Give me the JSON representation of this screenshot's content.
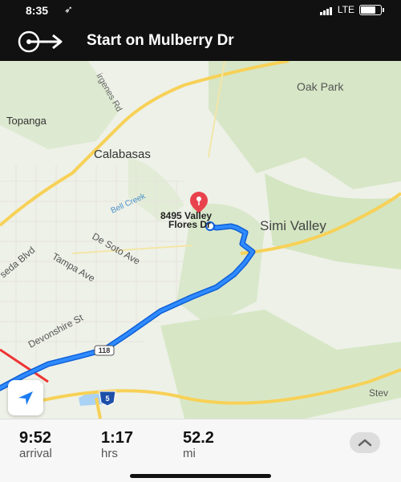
{
  "status_bar": {
    "time": "8:35",
    "network": "LTE"
  },
  "navigation": {
    "instruction": "Start on Mulberry Dr"
  },
  "map": {
    "place_labels": {
      "oak_park": "Oak Park",
      "topanga": "Topanga",
      "calabasas": "Calabasas",
      "simi_valley": "Simi Valley",
      "stev": "Stev"
    },
    "street_labels": {
      "virgenes": "irgenes Rd",
      "bell_creek": "Bell Creek",
      "de_soto": "De Soto Ave",
      "tampa": "Tampa Ave",
      "reseda": "seda Blvd",
      "devonshire": "Devonshire St"
    },
    "route_shields": {
      "hwy118": "118",
      "i5": "5"
    },
    "destination": {
      "line1": "8495 Valley",
      "line2": "Flores Dr"
    },
    "colors": {
      "route": "#1a7cf2",
      "pin": "#e8434c",
      "land": "#ecf0e6",
      "green": "#cfe2bd",
      "highway": "#f7d157"
    }
  },
  "trip": {
    "arrival_time": "9:52",
    "arrival_label": "arrival",
    "duration": "1:17",
    "duration_label": "hrs",
    "distance": "52.2",
    "distance_label": "mi"
  }
}
